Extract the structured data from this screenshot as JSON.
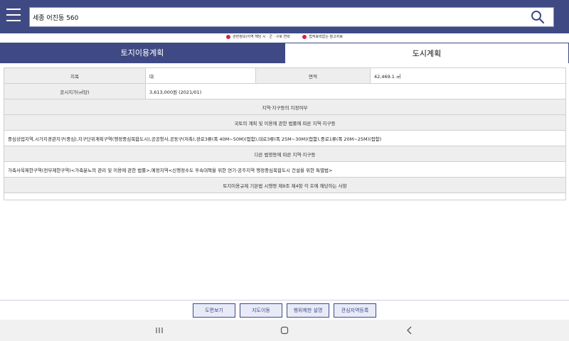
{
  "search": {
    "value": "세종 어진동 560"
  },
  "notices": [
    "관련정보(지역 해당 시 · 군 · 구로 연락",
    "법적효력없는 참고자료"
  ],
  "tabs": [
    {
      "label": "토지이용계획",
      "active": true
    },
    {
      "label": "도시계획",
      "active": false
    }
  ],
  "land_info": {
    "jimok_label": "지목",
    "jimok_value": "대",
    "area_label": "면적",
    "area_value": "42,469.1 ㎡",
    "price_label": "공시지가(㎡당)",
    "price_value": "3,613,000원 (2021/01)"
  },
  "zoning": {
    "header": "지역·지구등의 지정여부",
    "national_law_header": "국토의 계획 및 이용에 관한 법률에 따른 지역·지구등",
    "national_law_value": "중심상업지역,시가지경관지구(중심),지구단위계획구역(행정중심복합도시),공공청사,공동구(저촉),광로3류(폭 40M~50M)(접함),대로3류(폭 25M~30M)(접함),중로1류(폭 20M~25M)(접함)",
    "other_law_header": "다른 법령등에 따른 지역·지구등",
    "other_law_value": "가축사육제한구역(전부제한구역)<가축분뇨의 관리 및 이용에 관한 법률>,예정지역<신행정수도 후속대책을 위한 연기·공주지역 행정중심복합도시 건설을 위한 특별법>",
    "enforcement_header": "토지이용규제 기본법 시행령 제9조 제4항 각 호에 해당하는 사항",
    "enforcement_value": ""
  },
  "buttons": {
    "map_view": "도면보기",
    "map_move": "지도이동",
    "restriction": "행위제한 설명",
    "interest_region": "관심지역등록"
  },
  "icons": {
    "menu": "hamburger-menu-icon",
    "search": "search-icon",
    "warn": "exclamation-icon",
    "recent": "recent-apps-icon",
    "home": "home-icon",
    "back": "back-icon"
  },
  "colors": {
    "primary": "#3f4a85",
    "warn": "#d7263d",
    "label_bg": "#eeeeee"
  }
}
